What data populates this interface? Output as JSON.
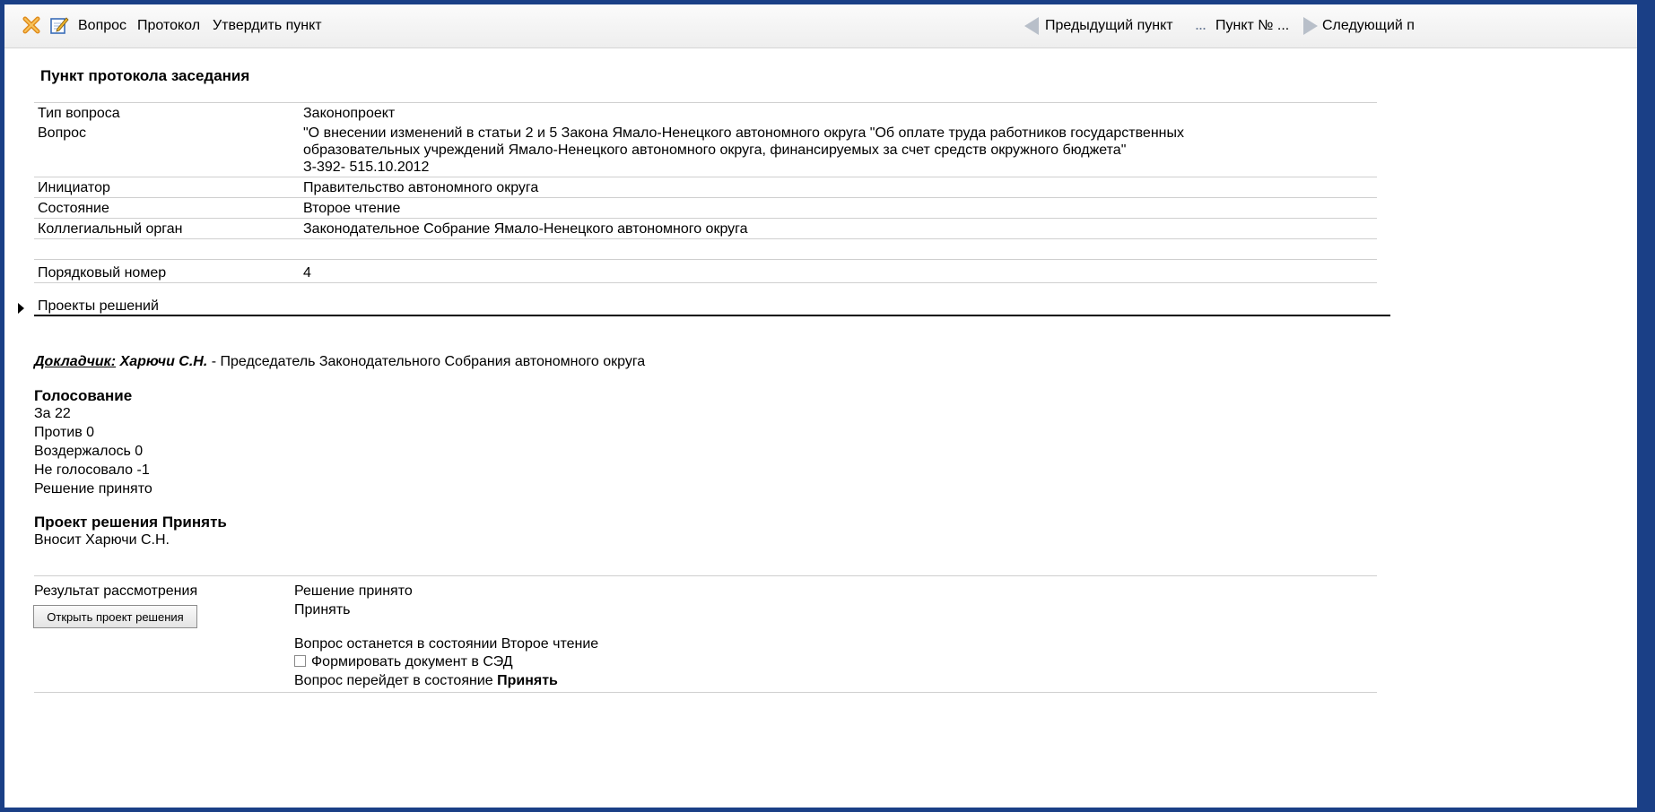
{
  "toolbar": {
    "icons": [
      "close-icon",
      "edit-icon"
    ],
    "vopros": "Вопрос",
    "protokol": "Протокол",
    "utverdit": "Утвердить пункт",
    "prev": "Предыдущий пункт",
    "dots": "...",
    "punkt_no": "Пункт № ...",
    "next": "Следующий п"
  },
  "section_title": "Пункт протокола заседания",
  "props": {
    "tip_label": "Тип вопроса",
    "tip_value": "Законопроект",
    "vopros_label": "Вопрос",
    "vopros_line1": "\"О внесении изменений в статьи 2 и 5 Закона Ямало-Ненецкого автономного округа \"Об оплате труда работников государственных",
    "vopros_line2": "образовательных учреждений Ямало-Ненецкого автономного округа, финансируемых за счет средств окружного бюджета\"",
    "vopros_line3": "З-392- 515.10.2012",
    "initiator_label": "Инициатор",
    "initiator_value": "Правительство автономного округа",
    "state_label": "Состояние",
    "state_value": "Второе чтение",
    "organ_label": "Коллегиальный орган",
    "organ_value": "Законодательное Собрание Ямало-Ненецкого автономного округа",
    "order_label": "Порядковый номер",
    "order_value": "4"
  },
  "projects_label": "Проекты решений",
  "reporter": {
    "label": "Докладчик:",
    "name": "Харючи С.Н.",
    "rest": " - Председатель Законодательного Собрания автономного округа"
  },
  "voting": {
    "title": "Голосование",
    "za": "За 22",
    "protiv": "Против 0",
    "vozderzh": "Воздержалось 0",
    "ne_golos": "Не голосовало -1",
    "result": "Решение принято"
  },
  "draft": {
    "title": "Проект решения Принять",
    "author": "Вносит Харючи С.Н."
  },
  "result": {
    "label": "Результат рассмотрения",
    "open_button": "Открыть проект решения",
    "line1": "Решение принято",
    "line2": "Принять",
    "line3": "Вопрос останется в состоянии Второе чтение",
    "checkbox_label": "Формировать документ в СЭД",
    "line5_prefix": "Вопрос перейдет в состояние ",
    "line5_bold": "Принять"
  }
}
